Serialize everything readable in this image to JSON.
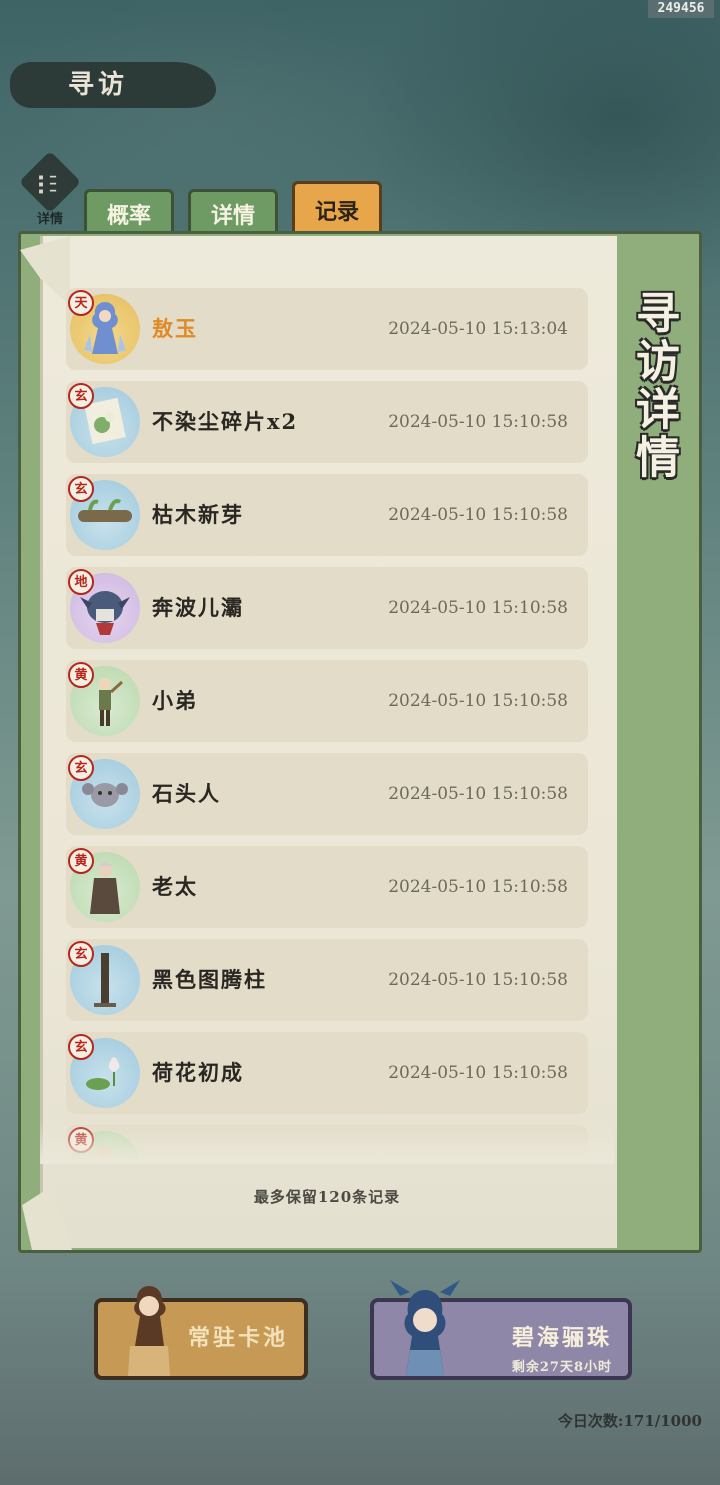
{
  "header": {
    "uid": "249456",
    "title": "寻访"
  },
  "detail_badge": {
    "label": "详情",
    "icon": "menu-lines-icon"
  },
  "tabs": [
    {
      "label": "概率",
      "active": false
    },
    {
      "label": "详情",
      "active": false
    },
    {
      "label": "记录",
      "active": true
    }
  ],
  "panel": {
    "side_title": "寻访详情",
    "footer_note": "最多保留120条记录"
  },
  "records": [
    {
      "seal": "天",
      "name": "敖玉",
      "time": "2024-05-10  15:13:04",
      "rarity": "gold",
      "icon": "dragon-lady-portrait"
    },
    {
      "seal": "玄",
      "name": "不染尘碎片x2",
      "time": "2024-05-10  15:10:58",
      "rarity": "blue",
      "icon": "lotus-scroll-fragment"
    },
    {
      "seal": "玄",
      "name": "枯木新芽",
      "time": "2024-05-10  15:10:58",
      "rarity": "blue",
      "icon": "log-sprout"
    },
    {
      "seal": "地",
      "name": "奔波儿灞",
      "time": "2024-05-10  15:10:58",
      "rarity": "purple",
      "icon": "fish-demon-portrait"
    },
    {
      "seal": "黄",
      "name": "小弟",
      "time": "2024-05-10  15:10:58",
      "rarity": "green",
      "icon": "boy-portrait"
    },
    {
      "seal": "玄",
      "name": "石头人",
      "time": "2024-05-10  15:10:58",
      "rarity": "blue",
      "icon": "stone-creature"
    },
    {
      "seal": "黄",
      "name": "老太",
      "time": "2024-05-10  15:10:58",
      "rarity": "green",
      "icon": "old-woman-portrait"
    },
    {
      "seal": "玄",
      "name": "黑色图腾柱",
      "time": "2024-05-10  15:10:58",
      "rarity": "blue",
      "icon": "totem-pole"
    },
    {
      "seal": "玄",
      "name": "荷花初成",
      "time": "2024-05-10  15:10:58",
      "rarity": "blue",
      "icon": "lotus-flower"
    },
    {
      "seal": "黄",
      "name": "",
      "time": "",
      "rarity": "green",
      "icon": "partial-portrait"
    }
  ],
  "pools": {
    "standard": {
      "label": "常驻卡池"
    },
    "limited": {
      "label": "碧海骊珠",
      "sub": "剩余27天8小时"
    }
  },
  "daily": "今日次数:171/1000",
  "colors": {
    "active_tab": "#e7a64a",
    "inactive_tab": "#6e9a63",
    "gold_name": "#e08a25",
    "seal_red": "#b7261d"
  }
}
